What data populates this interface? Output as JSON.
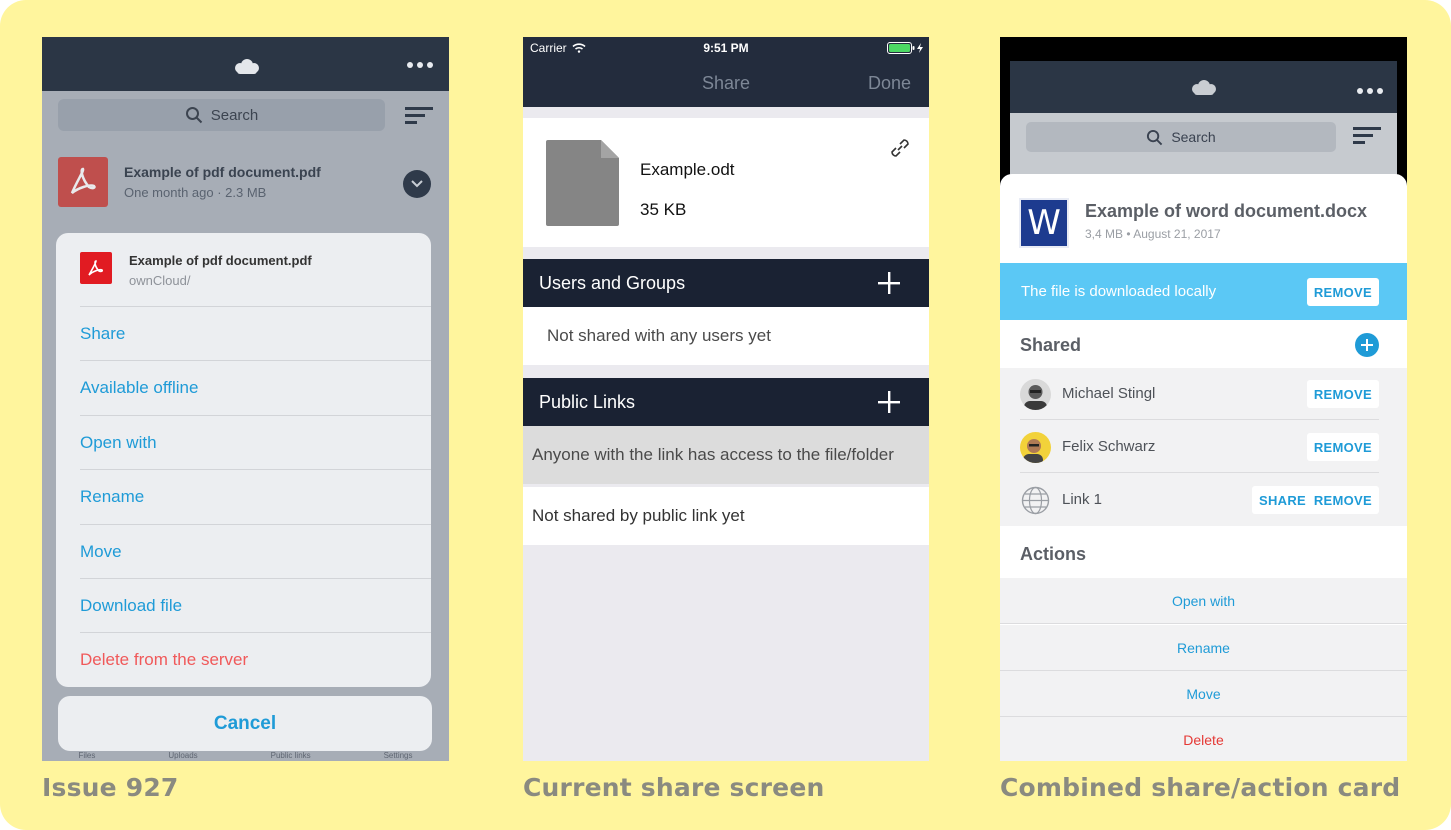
{
  "captions": {
    "issue": "Issue 927",
    "current": "Current share screen",
    "combined": "Combined share/action card"
  },
  "colors": {
    "background": "#fff59d",
    "accent": "#1f9bd7",
    "danger": "#f0595a",
    "navbar": "#2b3645",
    "banner": "#5bc8f5"
  },
  "panel1": {
    "search_placeholder": "Search",
    "file": {
      "name": "Example of pdf document.pdf",
      "meta": "One month ago · 2.3 MB",
      "icon": "pdf-icon"
    },
    "sheet": {
      "title": "Example of pdf document.pdf",
      "path": "ownCloud/",
      "actions": [
        "Share",
        "Available offline",
        "Open with",
        "Rename",
        "Move",
        "Download file"
      ],
      "danger_action": "Delete from the server"
    },
    "cancel": "Cancel",
    "tabs": [
      "Files",
      "Uploads",
      "Public links",
      "Settings"
    ]
  },
  "panel2": {
    "status": {
      "carrier": "Carrier",
      "time": "9:51 PM"
    },
    "nav": {
      "title": "Share",
      "done": "Done"
    },
    "file": {
      "name": "Example.odt",
      "size": "35 KB"
    },
    "users_section": {
      "title": "Users and Groups",
      "empty": "Not shared with any users yet"
    },
    "links_section": {
      "title": "Public Links",
      "info": "Anyone with the link has access to the file/folder",
      "empty": "Not shared by public link yet"
    }
  },
  "panel3": {
    "search_placeholder": "Search",
    "file": {
      "name": "Example of word document.docx",
      "meta": "3,4 MB  •  August 21, 2017",
      "icon_letter": "W"
    },
    "banner": {
      "text": "The file is downloaded locally",
      "button": "REMOVE"
    },
    "shared": {
      "title": "Shared",
      "items": [
        {
          "name": "Michael Stingl",
          "remove": "REMOVE"
        },
        {
          "name": "Felix Schwarz",
          "remove": "REMOVE"
        },
        {
          "name": "Link 1",
          "share": "SHARE",
          "remove": "REMOVE"
        }
      ]
    },
    "actions": {
      "title": "Actions",
      "items": [
        "Open with",
        "Rename",
        "Move"
      ],
      "danger": "Delete"
    }
  }
}
